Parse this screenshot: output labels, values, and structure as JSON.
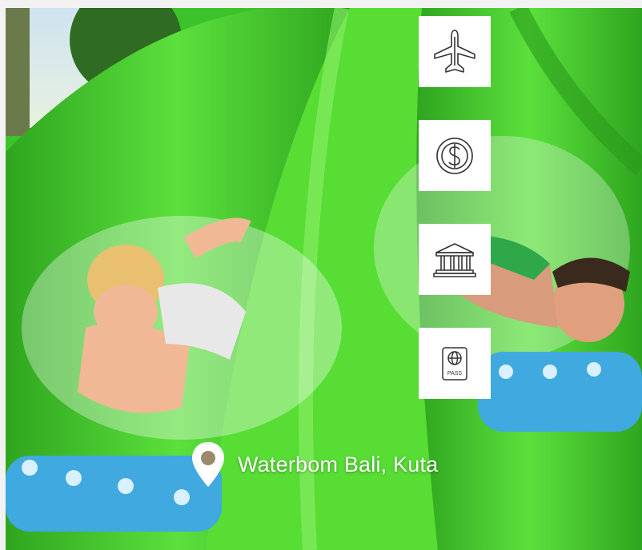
{
  "hero": {
    "image_icon": "waterslide-photo",
    "location_label": "Waterbom Bali, Kuta",
    "location_icon": "map-pin-icon"
  },
  "quick_links": [
    {
      "icon": "airplane-icon"
    },
    {
      "icon": "currency-icon"
    },
    {
      "icon": "bank-icon"
    },
    {
      "icon": "passport-icon",
      "badge_text": "PASS"
    }
  ],
  "colors": {
    "slide_green": "#46d12f",
    "tile_bg": "#ffffff",
    "icon_stroke": "#333333",
    "label": "#ffffff"
  }
}
